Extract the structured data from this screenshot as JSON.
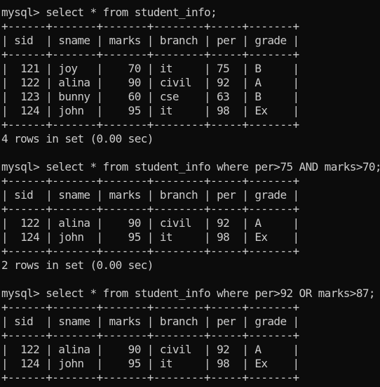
{
  "terminal": {
    "lines": [
      "mysql> select * from student_info;",
      "+------+-------+-------+--------+-----+-------+",
      "| sid  | sname | marks | branch | per | grade |",
      "+------+-------+-------+--------+-----+-------+",
      "|  121 | joy   |    70 | it     | 75  | B     |",
      "|  122 | alina |    90 | civil  | 92  | A     |",
      "|  123 | bunny |    60 | cse    | 63  | B     |",
      "|  124 | john  |    95 | it     | 98  | Ex    |",
      "+------+-------+-------+--------+-----+-------+",
      "4 rows in set (0.00 sec)",
      "",
      "mysql> select * from student_info where per>75 AND marks>70;",
      "+------+-------+-------+--------+-----+-------+",
      "| sid  | sname | marks | branch | per | grade |",
      "+------+-------+-------+--------+-----+-------+",
      "|  122 | alina |    90 | civil  | 92  | A     |",
      "|  124 | john  |    95 | it     | 98  | Ex    |",
      "+------+-------+-------+--------+-----+-------+",
      "2 rows in set (0.00 sec)",
      "",
      "mysql> select * from student_info where per>92 OR marks>87;",
      "+------+-------+-------+--------+-----+-------+",
      "| sid  | sname | marks | branch | per | grade |",
      "+------+-------+-------+--------+-----+-------+",
      "|  122 | alina |    90 | civil  | 92  | A     |",
      "|  124 | john  |    95 | it     | 98  | Ex    |",
      "+------+-------+-------+--------+-----+-------+"
    ]
  }
}
